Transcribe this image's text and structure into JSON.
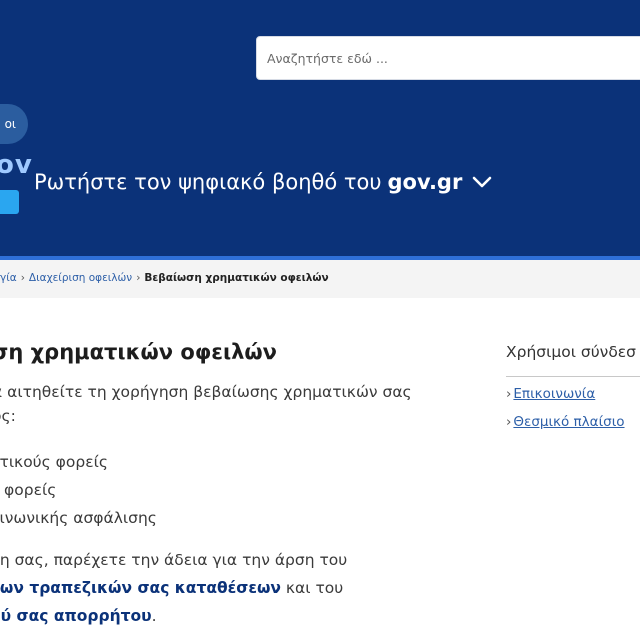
{
  "header": {
    "search": {
      "placeholder": "Αναζητήστε εδώ ...",
      "value": ""
    },
    "language_toggle": "οι",
    "logo_text": "ov",
    "assistant": {
      "prefix": "Ρωτήστε τον ψηφιακό βοηθό του",
      "brand": "gov.gr",
      "icon": "chevron-down-icon"
    },
    "colors": {
      "header_bg": "#0b3279",
      "accent": "#2aa6f0"
    }
  },
  "breadcrumb": {
    "items": [
      "γία",
      "Διαχείριση οφειλών"
    ],
    "current": "Βεβαίωση χρηματικών οφειλών"
  },
  "main": {
    "title": "ση χρηματικών οφειλών",
    "paragraph1": [
      "α αιτηθείτε τη χορήγηση βεβαίωσης χρηματικών σας",
      "ος:"
    ],
    "list": [
      "οτικούς φορείς",
      "ς φορείς",
      "οινωνικής ασφάλισης"
    ],
    "paragraph2": {
      "line1": "ση σας, παρέχετε την άδεια για την άρση του",
      "line2_strong": "των τραπεζικών σας καταθέσεων",
      "line2_rest": " και του",
      "line3_strong": "ού σας απορρήτου",
      "line3_rest": "."
    }
  },
  "aside": {
    "title": "Χρήσιμοι σύνδεσ",
    "links": [
      "Επικοινωνία",
      "Θεσμικό πλαίσιο"
    ]
  }
}
